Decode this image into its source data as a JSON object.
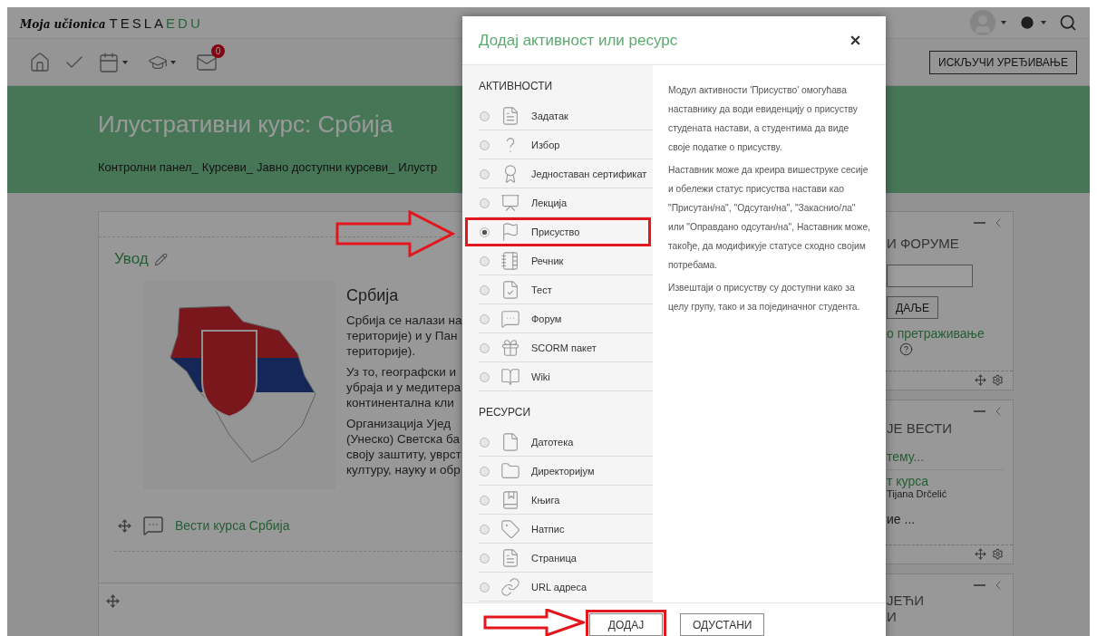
{
  "logo": {
    "script": "Moja učionica",
    "brand": "TESLA",
    "brand_accent": "EDU"
  },
  "toolbar": {
    "message_count": "0",
    "edit_button": "ИСКЉУЧИ УРЕЂИВАЊЕ"
  },
  "course_header": {
    "title": "Илустративни курс: Србија",
    "breadcrumb": [
      "Контролни панел_",
      "Курсеви_",
      "Јавно доступни курсеви_",
      "Илустр"
    ]
  },
  "section": {
    "title": "Увод",
    "summary_title": "Србија",
    "paragraphs": [
      [
        "Србија се налази на",
        "територије) и у Пан",
        "територије)."
      ],
      [
        "Уз то, географски и",
        "убраја и у медитера",
        "континентална кли"
      ],
      [
        "Организација Ујед",
        "(Унеско) Светска ба",
        "своју заштиту, уврст",
        "културу, науку и обр"
      ]
    ],
    "activity_link": "Вести курса Србија"
  },
  "blocks": [
    {
      "kind": "search",
      "title_lines": [
        "И ФОРУМЕ"
      ],
      "button": "ДАЉЕ",
      "link": "о претраживање"
    },
    {
      "kind": "news",
      "title_lines": [
        "ЈЕ ВЕСТИ"
      ],
      "add_link": "тему...",
      "post_title": "т курса",
      "post_author": "Tijana Drčelić",
      "more_link": "ие ..."
    },
    {
      "kind": "events",
      "title_lines": [
        "ЈЕЋИ",
        "И"
      ]
    }
  ],
  "dialog": {
    "title": "Додај активност или ресурс",
    "groups": [
      {
        "heading": "АКТИВНОСТИ",
        "items": [
          {
            "label": "Задатак",
            "selected": false
          },
          {
            "label": "Избор",
            "selected": false
          },
          {
            "label": "Једноставан сертификат",
            "selected": false
          },
          {
            "label": "Лекција",
            "selected": false
          },
          {
            "label": "Присуство",
            "selected": true
          },
          {
            "label": "Речник",
            "selected": false
          },
          {
            "label": "Тест",
            "selected": false
          },
          {
            "label": "Форум",
            "selected": false
          },
          {
            "label": "SCORM пакет",
            "selected": false
          },
          {
            "label": "Wiki",
            "selected": false
          }
        ]
      },
      {
        "heading": "РЕСУРСИ",
        "items": [
          {
            "label": "Датотека",
            "selected": false
          },
          {
            "label": "Директоријум",
            "selected": false
          },
          {
            "label": "Књига",
            "selected": false
          },
          {
            "label": "Натпис",
            "selected": false
          },
          {
            "label": "Страница",
            "selected": false
          },
          {
            "label": "URL адреса",
            "selected": false
          }
        ]
      }
    ],
    "description": [
      "Модул активности 'Присуство' омогућава наставнику да води евиденцију о присуству студената настави, а студентима да виде своје податке о присуству.",
      "Наставник може да креира вишеструке сесије и обележи статус присуства настави као \"Присутан/на\", \"Одсутан/на\", \"Закаснио/ла\" или \"Оправдано одсутан/на\", Наставник може, такође, да модификује статусе сходно својим потребама.",
      "Извештаји о присуству су доступни како за целу групу, тако и за појединачног студента."
    ],
    "buttons": [
      {
        "label": "ДОДАЈ",
        "highlighted": true
      },
      {
        "label": "ОДУСТАНИ",
        "highlighted": false
      }
    ]
  }
}
